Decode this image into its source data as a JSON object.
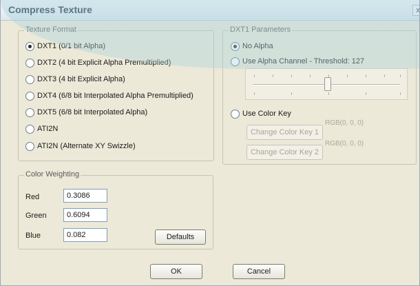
{
  "dialog": {
    "title": "Compress Texture",
    "close_glyph": "x"
  },
  "texture_format": {
    "legend": "Texture Format",
    "options": [
      {
        "label": "DXT1 (0/1 bit Alpha)",
        "selected": true
      },
      {
        "label": "DXT2 (4 bit Explicit Alpha Premultiplied)",
        "selected": false
      },
      {
        "label": "DXT3 (4 bit Explicit Alpha)",
        "selected": false
      },
      {
        "label": "DXT4 (6/8 bit Interpolated Alpha Premultiplied)",
        "selected": false
      },
      {
        "label": "DXT5 (6/8 bit Interpolated Alpha)",
        "selected": false
      },
      {
        "label": "ATI2N",
        "selected": false
      },
      {
        "label": "ATI2N (Alternate XY Swizzle)",
        "selected": false
      }
    ]
  },
  "dxt1_params": {
    "legend": "DXT1 Parameters",
    "no_alpha_label": "No Alpha",
    "alpha_channel_label": "Use Alpha Channel - Threshold: 127",
    "threshold_slider_fraction": 0.5,
    "use_color_key_label": "Use Color Key",
    "change_key_1_label": "Change Color Key 1",
    "change_key_2_label": "Change Color Key 2",
    "key_1_rgb": "RGB(0, 0, 0)",
    "key_2_rgb": "RGB(0, 0, 0)"
  },
  "color_weighting": {
    "legend": "Color Weighting",
    "red_label": "Red",
    "red_value": "0.3086",
    "green_label": "Green",
    "green_value": "0.6094",
    "blue_label": "Blue",
    "blue_value": "0.082",
    "defaults_label": "Defaults"
  },
  "footer": {
    "ok_label": "OK",
    "cancel_label": "Cancel"
  }
}
